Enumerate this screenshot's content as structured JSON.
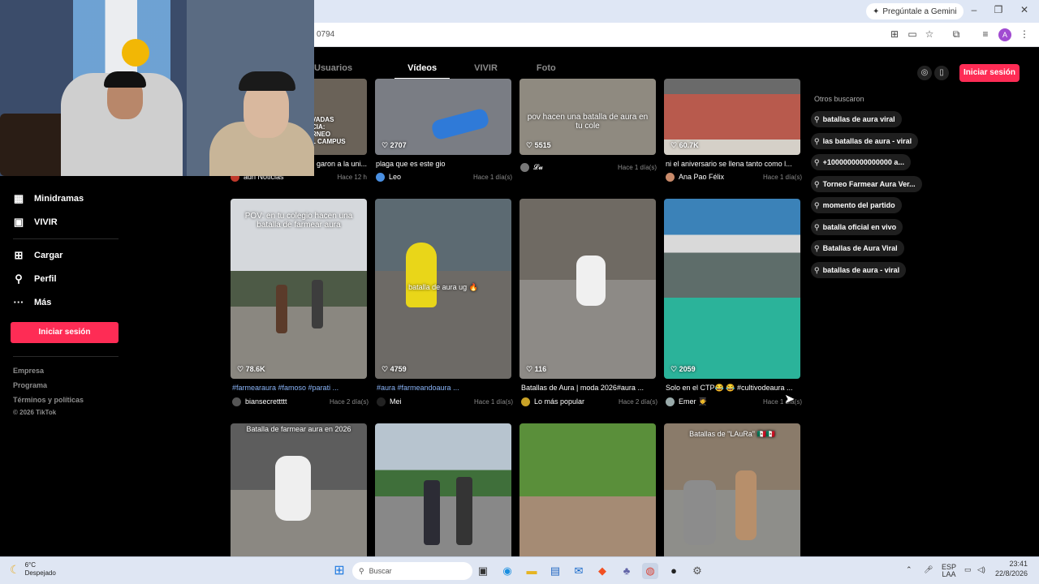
{
  "browser": {
    "gemini_label": "Pregúntale a Gemini",
    "url_fragment": "0794",
    "profile_initial": "A"
  },
  "tabs": [
    {
      "label": "Usuarios"
    },
    {
      "label": "Vídeos"
    },
    {
      "label": "VIVIR"
    },
    {
      "label": "Foto"
    }
  ],
  "header": {
    "login_label": "Iniciar sesión"
  },
  "sidebar": {
    "items": [
      {
        "label": "Minidramas",
        "icon": "film-icon"
      },
      {
        "label": "VIVIR",
        "icon": "live-icon"
      },
      {
        "label": "Cargar",
        "icon": "plus-square-icon"
      },
      {
        "label": "Perfil",
        "icon": "person-icon"
      },
      {
        "label": "Más",
        "icon": "more-icon"
      }
    ],
    "login_label": "Iniciar sesión",
    "footer_links": [
      "Empresa",
      "Programa",
      "Términos y políticas"
    ],
    "copyright": "© 2026 TikTok"
  },
  "videos": [
    {
      "likes": "",
      "overlay": "VADAS\nCIA:\nRNEO\nL CAMPUS",
      "caption": "garon a la uni...",
      "user": "adn Noticias",
      "time": "Hace 12 h"
    },
    {
      "likes": "2707",
      "overlay": "",
      "caption": "plaga que es este gio",
      "user": "Leo",
      "time": "Hace 1 día(s)"
    },
    {
      "likes": "5515",
      "overlay": "pov hacen una batalla de aura en tu cole",
      "caption": "",
      "user": "𝓛𝓾",
      "time": "Hace 1 día(s)"
    },
    {
      "likes": "60.7K",
      "overlay": "",
      "caption": "ni el aniversario se llena tanto como l...",
      "user": "Ana Pao Félix",
      "time": "Hace 1 día(s)"
    },
    {
      "likes": "78.6K",
      "overlay": "POV: en tu colegio hacen una batalla de farmear aura",
      "caption": "#farmearaura #famoso #parati ...",
      "user": "biansecrettttt",
      "time": "Hace 2 día(s)"
    },
    {
      "likes": "4759",
      "overlay": "batalla de aura ug 🔥",
      "caption": "#aura #farmeandoaura ...",
      "user": "Mei",
      "time": "Hace 1 día(s)"
    },
    {
      "likes": "116",
      "overlay": "",
      "caption": "Batallas de Aura | moda 2026#aura ...",
      "user": "Lo más popular",
      "time": "Hace 2 día(s)"
    },
    {
      "likes": "2059",
      "overlay": "",
      "caption": "Solo en el CTP😂 😂 #cultivodeaura ...",
      "user": "Emer 🧑‍🎓",
      "time": "Hace 1 día(s)"
    },
    {
      "likes": "",
      "overlay": "Batalla de farmear aura en 2026",
      "caption": "",
      "user": "",
      "time": ""
    },
    {
      "likes": "",
      "overlay": "",
      "caption": "",
      "user": "",
      "time": ""
    },
    {
      "likes": "",
      "overlay": "",
      "caption": "",
      "user": "",
      "time": ""
    },
    {
      "likes": "",
      "overlay": "Batallas de \"LAuRa\" 🇲🇽🇲🇽",
      "caption": "",
      "user": "",
      "time": ""
    }
  ],
  "related": {
    "title": "Otros buscaron",
    "items": [
      "batallas de aura viral",
      "las batallas de aura - viral",
      "+1000000000000000 a...",
      "Torneo Farmear Aura Ver...",
      "momento del partido",
      "batalla oficial en vivo",
      "Batallas de Aura Viral",
      "batallas de aura - viral"
    ]
  },
  "taskbar": {
    "temp": "6°C",
    "weather": "Despejado",
    "search_placeholder": "Buscar",
    "lang_top": "ESP",
    "lang_bottom": "LAA",
    "time": "23:41",
    "date": "22/8/2026"
  }
}
